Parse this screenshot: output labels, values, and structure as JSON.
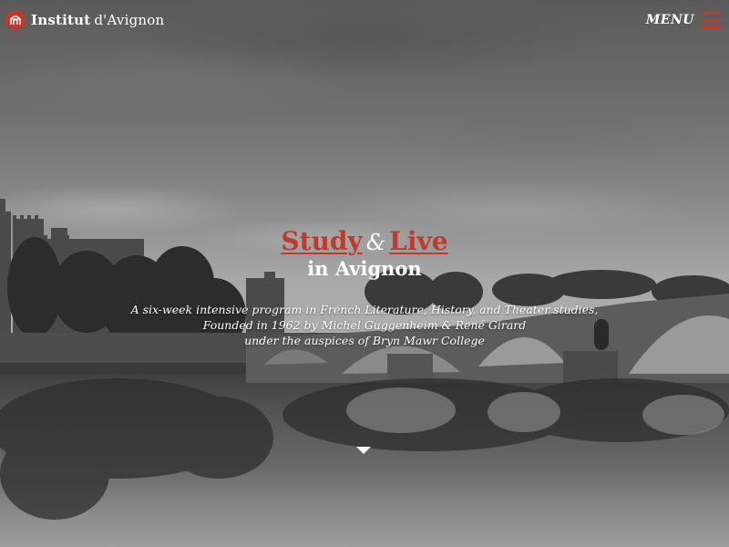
{
  "header": {
    "brand_strong": "Institut",
    "brand_light": "d'Avignon",
    "menu_label": "MENU",
    "logo_icon": "institut-seal-icon",
    "menu_icon": "hamburger-menu-icon"
  },
  "hero": {
    "study": "Study",
    "amp": "&",
    "live": "Live",
    "subtitle": "in Avignon",
    "description": [
      "A six-week intensive program in French Literature, History, and Theater studies,",
      "Founded in 1962 by Michel Guggenheim & René Girard",
      "under the auspices of Bryn Mawr College"
    ],
    "scroll_icon": "chevron-down-icon"
  },
  "colors": {
    "accent": "#c0392b",
    "text": "#ffffff"
  }
}
